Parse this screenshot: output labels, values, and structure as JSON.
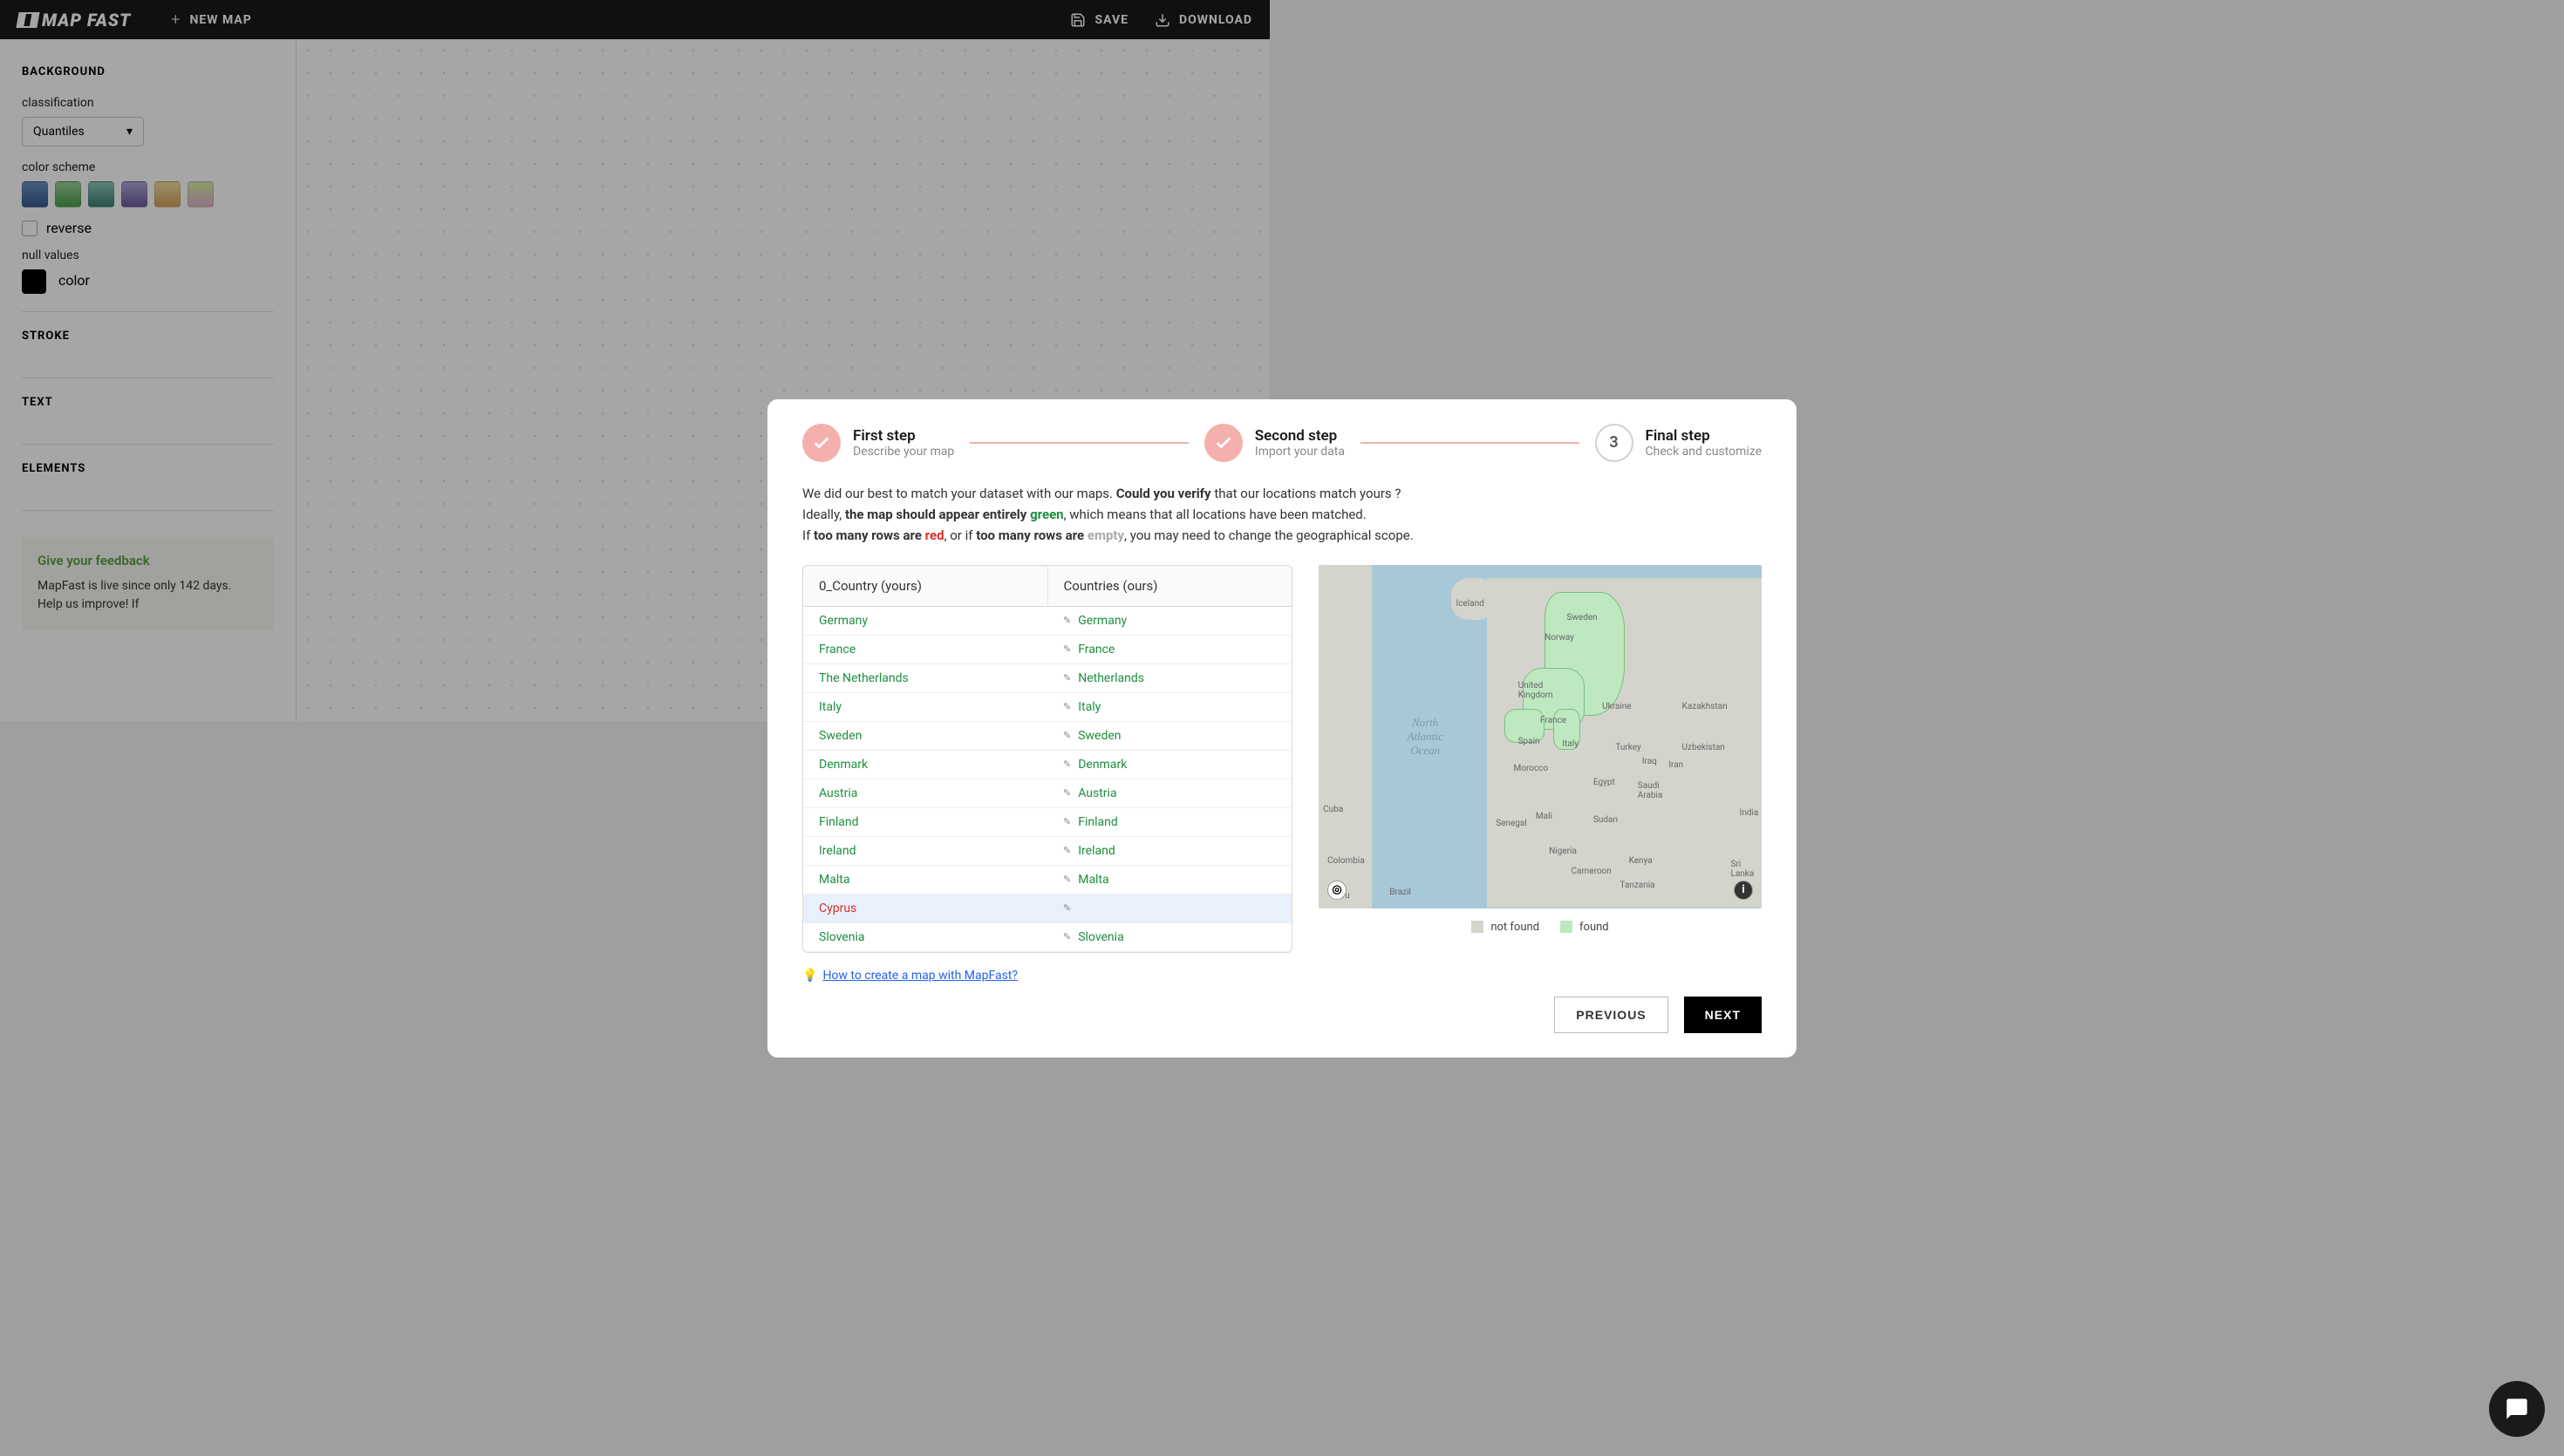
{
  "topbar": {
    "logo": "MAP FAST",
    "new_map": "NEW MAP",
    "save": "SAVE",
    "download": "DOWNLOAD"
  },
  "sidebar": {
    "background_title": "BACKGROUND",
    "classification_label": "classification",
    "classification_value": "Quantiles",
    "color_scheme_label": "color scheme",
    "reverse_label": "reverse",
    "null_values_label": "null values",
    "color_label": "color",
    "stroke_title": "STROKE",
    "text_title": "TEXT",
    "elements_title": "ELEMENTS",
    "feedback_title": "Give your feedback",
    "feedback_text": "MapFast is live since only 142 days. Help us improve! If"
  },
  "stepper": {
    "step1_title": "First step",
    "step1_sub": "Describe your map",
    "step2_title": "Second step",
    "step2_sub": "Import your data",
    "step3_num": "3",
    "step3_title": "Final step",
    "step3_sub": "Check and customize"
  },
  "intro": {
    "line1a": "We did our best to match your dataset with our maps. ",
    "line1b": "Could you verify",
    "line1c": " that our locations match yours ?",
    "line2a": "Ideally, ",
    "line2b": "the map should appear entirely ",
    "line2c": "green",
    "line2d": ", which means that all locations have been matched.",
    "line3a": "If ",
    "line3b": "too many rows are ",
    "line3c": "red",
    "line3d": ", or if ",
    "line3e": "too many rows are ",
    "line3f": "empty",
    "line3g": ", you may need to change the geographical scope."
  },
  "table": {
    "header_yours": "0_Country (yours)",
    "header_ours": "Countries (ours)",
    "rows": [
      {
        "yours": "Germany",
        "ours": "Germany",
        "matched": true
      },
      {
        "yours": "France",
        "ours": "France",
        "matched": true
      },
      {
        "yours": "The Netherlands",
        "ours": "Netherlands",
        "matched": true
      },
      {
        "yours": "Italy",
        "ours": "Italy",
        "matched": true
      },
      {
        "yours": "Sweden",
        "ours": "Sweden",
        "matched": true
      },
      {
        "yours": "Denmark",
        "ours": "Denmark",
        "matched": true
      },
      {
        "yours": "Austria",
        "ours": "Austria",
        "matched": true
      },
      {
        "yours": "Finland",
        "ours": "Finland",
        "matched": true
      },
      {
        "yours": "Ireland",
        "ours": "Ireland",
        "matched": true
      },
      {
        "yours": "Malta",
        "ours": "Malta",
        "matched": true
      },
      {
        "yours": "Cyprus",
        "ours": "",
        "matched": false
      },
      {
        "yours": "Slovenia",
        "ours": "Slovenia",
        "matched": true
      }
    ]
  },
  "map": {
    "ocean_label": "North\nAtlantic\nOcean",
    "countries": [
      "Iceland",
      "Sweden",
      "Norway",
      "United Kingdom",
      "France",
      "Spain",
      "Italy",
      "Ukraine",
      "Turkey",
      "Kazakhstan",
      "Uzbekistan",
      "Morocco",
      "Mali",
      "Senegal",
      "Sudan",
      "Egypt",
      "Saudi Arabia",
      "Iraq",
      "Iran",
      "India",
      "Sri Lanka",
      "Kenya",
      "Tanzania",
      "Nigeria",
      "Cameroon",
      "Cuba",
      "Colombia",
      "Peru",
      "Brazil"
    ]
  },
  "legend": {
    "not_found": "not found",
    "found": "found"
  },
  "help": {
    "link": "How to create a map with MapFast?"
  },
  "footer": {
    "previous": "PREVIOUS",
    "next": "NEXT"
  }
}
